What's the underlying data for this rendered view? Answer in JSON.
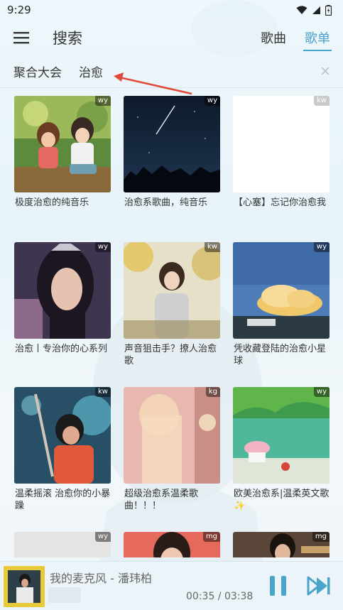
{
  "status_bar": {
    "time": "9:29"
  },
  "header": {
    "title": "搜索",
    "tabs": [
      {
        "label": "歌曲",
        "active": false
      },
      {
        "label": "歌单",
        "active": true
      }
    ]
  },
  "search": {
    "source": "聚合大会",
    "query": "治愈"
  },
  "playlists": [
    {
      "title": "极度治愈的纯音乐",
      "badge": "wy"
    },
    {
      "title": "治愈系歌曲，纯音乐",
      "badge": "wy"
    },
    {
      "title": "【心塞】忘记你治愈我",
      "badge": "kw"
    },
    {
      "title": "治愈丨专治你的心系列",
      "badge": "wy"
    },
    {
      "title": "声音狙击手？撩人治愈歌",
      "badge": "kw"
    },
    {
      "title": "凭收藏登陆的治愈小星球",
      "badge": "wy"
    },
    {
      "title": "温柔摇滚 治愈你的小暴躁",
      "badge": "kw"
    },
    {
      "title": "超级治愈系温柔歌曲！！！",
      "badge": "kg"
    },
    {
      "title": "欧美治愈系|温柔英文歌✨",
      "badge": "wy"
    },
    {
      "title": "",
      "badge": "wy"
    },
    {
      "title": "",
      "badge": "mg"
    },
    {
      "title": "",
      "badge": "mg"
    }
  ],
  "player": {
    "track": "我的麦克风 - 潘玮柏",
    "time": "00:35 / 03:38",
    "progress": 0.16
  },
  "colors": {
    "accent": "#4aa3c8",
    "annotation_arrow": "#e04a3a"
  }
}
